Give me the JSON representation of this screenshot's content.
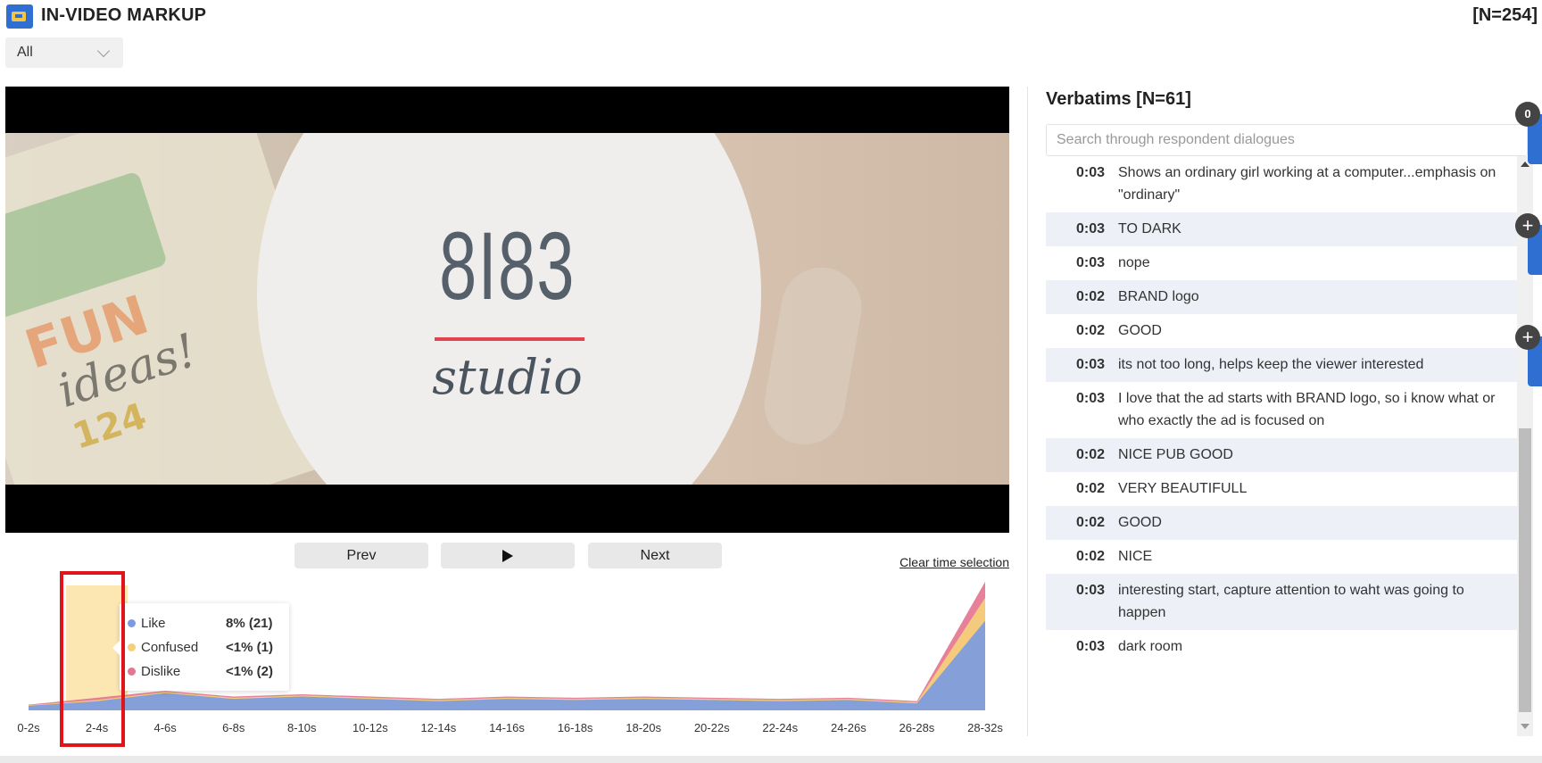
{
  "header": {
    "title": "IN-VIDEO MARKUP",
    "total_n": "[N=254]"
  },
  "filter": {
    "value": "All"
  },
  "video": {
    "logo_number": "8I83",
    "logo_sub": "studio",
    "mag_fun": "FUN",
    "mag_ideas": "ideas!",
    "mag_num": "124"
  },
  "controls": {
    "prev": "Prev",
    "next": "Next",
    "clear": "Clear time selection"
  },
  "tooltip": {
    "rows": [
      {
        "label": "Like",
        "value": "8% (21)",
        "color": "#7b9be0"
      },
      {
        "label": "Confused",
        "value": "<1% (1)",
        "color": "#f5d07a"
      },
      {
        "label": "Dislike",
        "value": "<1% (2)",
        "color": "#e57591"
      }
    ]
  },
  "chart_data": {
    "type": "area",
    "categories": [
      "0-2s",
      "2-4s",
      "4-6s",
      "6-8s",
      "8-10s",
      "10-12s",
      "12-14s",
      "14-16s",
      "16-18s",
      "18-20s",
      "20-22s",
      "22-24s",
      "24-26s",
      "26-28s",
      "28-32s"
    ],
    "series": [
      {
        "name": "Like",
        "color": "#7b9be0",
        "values": [
          4,
          8,
          15,
          10,
          12,
          10,
          8,
          10,
          9,
          10,
          9,
          8,
          9,
          6,
          78
        ]
      },
      {
        "name": "Confused",
        "color": "#f5d07a",
        "values": [
          0.5,
          1,
          1,
          1,
          1,
          1,
          1,
          1,
          1,
          1,
          1,
          1,
          1,
          1,
          20
        ]
      },
      {
        "name": "Dislike",
        "color": "#e57591",
        "values": [
          0.5,
          2,
          1,
          1,
          1,
          1,
          1,
          1,
          1,
          1,
          1,
          1,
          1,
          1,
          14
        ]
      }
    ],
    "selected_category": "2-4s",
    "ylim": [
      0,
      115
    ]
  },
  "verbatims": {
    "title": "Verbatims [N=61]",
    "search_placeholder": "Search through respondent dialogues",
    "badge_count": "0",
    "items": [
      {
        "time": "0:03",
        "text": "Shows an ordinary girl working at a computer...emphasis on \"ordinary\""
      },
      {
        "time": "0:03",
        "text": "TO DARK"
      },
      {
        "time": "0:03",
        "text": "nope"
      },
      {
        "time": "0:02",
        "text": "BRAND logo"
      },
      {
        "time": "0:02",
        "text": "GOOD"
      },
      {
        "time": "0:03",
        "text": "its not too long, helps keep the viewer interested"
      },
      {
        "time": "0:03",
        "text": "I love that the ad starts with BRAND logo, so i know what or who exactly the ad is focused on"
      },
      {
        "time": "0:02",
        "text": "NICE PUB GOOD"
      },
      {
        "time": "0:02",
        "text": "VERY BEAUTIFULL"
      },
      {
        "time": "0:02",
        "text": "GOOD"
      },
      {
        "time": "0:02",
        "text": "NICE"
      },
      {
        "time": "0:03",
        "text": "interesting start, capture attention to waht was going to happen"
      },
      {
        "time": "0:03",
        "text": "dark room"
      }
    ]
  }
}
